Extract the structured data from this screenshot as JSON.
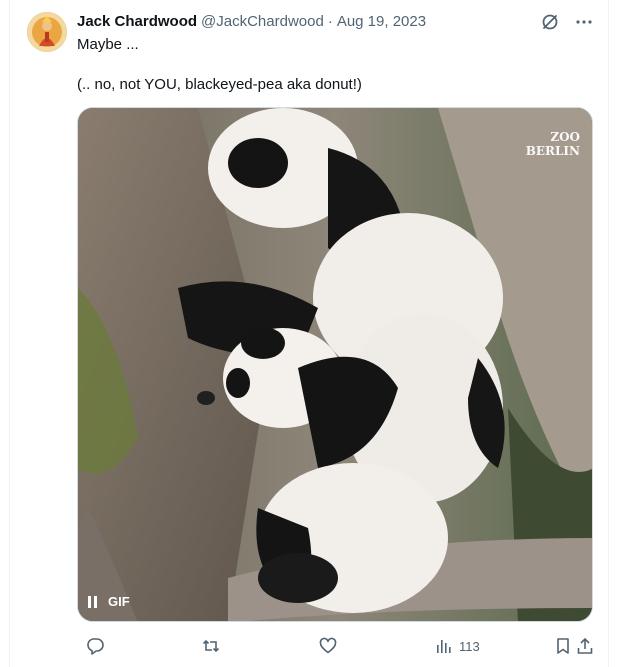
{
  "tweet": {
    "author_name": "Jack Chardwood",
    "handle": "@JackChardwood",
    "separator": "·",
    "date": "Aug 19, 2023",
    "text_line_1": "Maybe ...",
    "text_line_2": "(.. no, not YOU, blackeyed-pea aka donut!)"
  },
  "media": {
    "badge_label": "GIF",
    "watermark_line_1": "ZOO",
    "watermark_line_2": "BERLIN"
  },
  "actions": {
    "views_count": "113"
  },
  "icons": {
    "header": [
      "grok-icon",
      "more-icon"
    ],
    "bar": [
      "reply-icon",
      "retweet-icon",
      "like-icon",
      "views-icon",
      "bookmark-icon",
      "share-icon"
    ]
  },
  "colors": {
    "text": "#0f1419",
    "secondary": "#536471",
    "border": "#cfd9de"
  }
}
